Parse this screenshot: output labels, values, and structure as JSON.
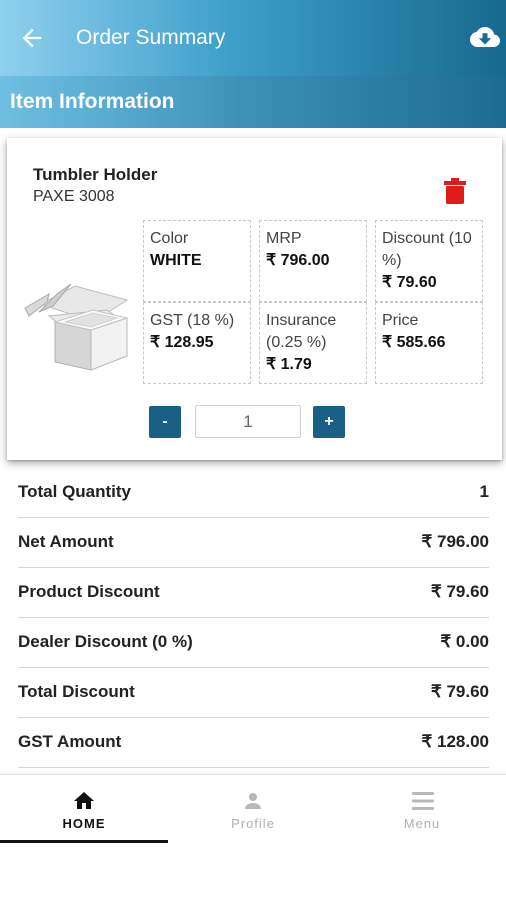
{
  "appbar": {
    "title": "Order Summary",
    "back_icon": "arrow-left-icon",
    "action_icon": "cloud-download-icon"
  },
  "section": {
    "label": "Item Information"
  },
  "item": {
    "name": "Tumbler Holder",
    "code": "PAXE 3008",
    "delete_icon": "trash-icon",
    "attributes": [
      {
        "label": "Color",
        "value": "WHITE"
      },
      {
        "label": "MRP",
        "value": "₹ 796.00"
      },
      {
        "label": "Discount (10 %)",
        "value": "₹ 79.60"
      },
      {
        "label": "GST (18 %)",
        "value": "₹ 128.95"
      },
      {
        "label": "Insurance (0.25 %)",
        "value": "₹ 1.79"
      },
      {
        "label": "Price",
        "value": "₹ 585.66"
      }
    ],
    "quantity": {
      "minus_label": "-",
      "plus_label": "+",
      "value": "1"
    }
  },
  "summary": [
    {
      "label": "Total Quantity",
      "value": "1"
    },
    {
      "label": "Net Amount",
      "value": "₹ 796.00"
    },
    {
      "label": "Product Discount",
      "value": "₹ 79.60"
    },
    {
      "label": "Dealer Discount (0 %)",
      "value": "₹ 0.00"
    },
    {
      "label": "Total Discount",
      "value": "₹ 79.60"
    },
    {
      "label": "GST Amount",
      "value": "₹ 128.00"
    }
  ],
  "bottom_nav": [
    {
      "label": "HOME",
      "icon": "home-icon",
      "active": true
    },
    {
      "label": "Profile",
      "icon": "person-icon",
      "active": false
    },
    {
      "label": "Menu",
      "icon": "hamburger-menu-icon",
      "active": false
    }
  ],
  "colors": {
    "accent": "#1a5f86",
    "delete": "#e01b1b",
    "appbar_start": "#8fd0ee",
    "appbar_end": "#17698f"
  }
}
